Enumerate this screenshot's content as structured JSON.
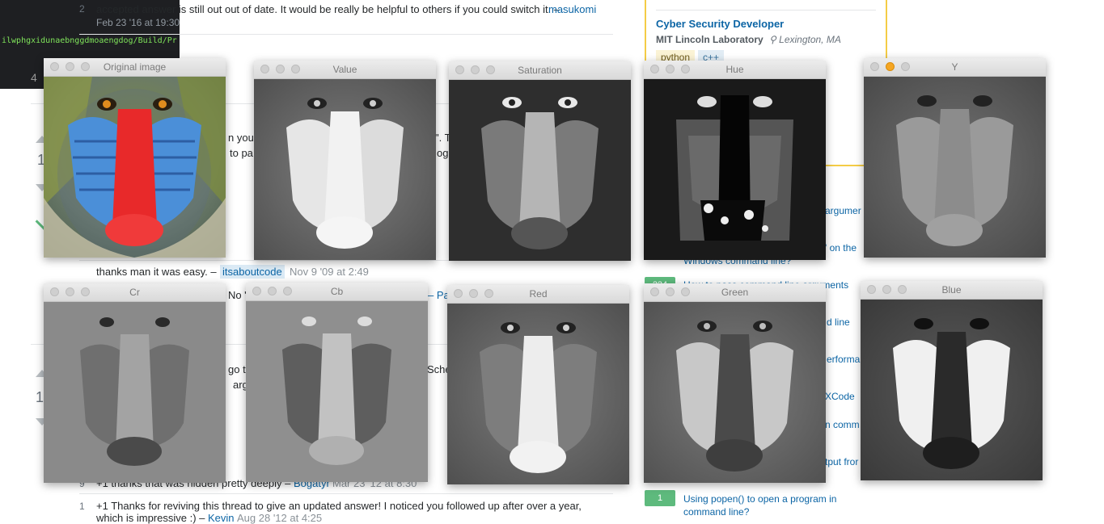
{
  "terminal": {
    "path_text": "ilwphgxidunaebnggdmoaengdog/Build/Pr",
    "tab_digit": "4"
  },
  "page": {
    "comments": [
      {
        "num": "2",
        "text": "accepted answer is still out out of date. It would be really be helpful to others if you could switch it. –",
        "user": "masukomi",
        "date": "Feb 23 '16 at 19:30"
      },
      {
        "num": "",
        "text": "thanks man it was easy. –",
        "user": "itsaboutcode",
        "date": "Nov 9 '09 at 2:49"
      },
      {
        "num": "9",
        "text": "+1 thanks that was hidden pretty deeply –",
        "user": "Bogatyr",
        "date": "Mar 23 '12 at 8:30"
      },
      {
        "num": "1",
        "text": "+1 Thanks for reviving this thread to give an updated answer! I noticed you followed up after over a year,",
        "line2": "which is impressive :) –",
        "user": "Kevin",
        "date": "Aug 28 '12 at 4:25"
      }
    ],
    "fragments": {
      "frag_1": "n your",
      "frag_2": "to pa",
      "frag_3": "No \"C",
      "frag_4": "– Pa",
      "frag_5": "go t",
      "frag_6": "arg",
      "frag_7": "Sche",
      "frag_8": "\". T",
      "frag_9": "og",
      "vote_1": "1",
      "vote_2": "1"
    },
    "job": {
      "title": "Cyber Security Developer",
      "company": "MIT Lincoln Laboratory",
      "location": "Lexington, MA",
      "tags": [
        "python",
        "c++"
      ]
    },
    "related": [
      {
        "text": "argumer"
      },
      {
        "text": "' on the"
      },
      {
        "text": "Windows command line?"
      },
      {
        "text": "How to pass command line arguments",
        "score": "224"
      },
      {
        "text": "d line"
      },
      {
        "text": "erforma"
      },
      {
        "text": "XCode"
      },
      {
        "text": "n comm"
      },
      {
        "text": "tput fror"
      },
      {
        "text": "Using popen() to open a program in",
        "line2": "command line?",
        "score": "1"
      }
    ]
  },
  "windows": [
    {
      "id": "original",
      "title": "Original image",
      "mode": "color"
    },
    {
      "id": "value",
      "title": "Value",
      "mode": "gray-bright"
    },
    {
      "id": "saturation",
      "title": "Saturation",
      "mode": "gray-dark"
    },
    {
      "id": "hue",
      "title": "Hue",
      "mode": "hue"
    },
    {
      "id": "y",
      "title": "Y",
      "mode": "gray-mid"
    },
    {
      "id": "cr",
      "title": "Cr",
      "mode": "flat"
    },
    {
      "id": "cb",
      "title": "Cb",
      "mode": "flat-light"
    },
    {
      "id": "red",
      "title": "Red",
      "mode": "gray-bright"
    },
    {
      "id": "green",
      "title": "Green",
      "mode": "gray-mid"
    },
    {
      "id": "blue",
      "title": "Blue",
      "mode": "gray-dark"
    }
  ],
  "colors": {
    "link": "#0c65a5",
    "job_border": "#f4cc46",
    "score_green": "#5eba7d",
    "terminal_text": "#7fe35a"
  }
}
